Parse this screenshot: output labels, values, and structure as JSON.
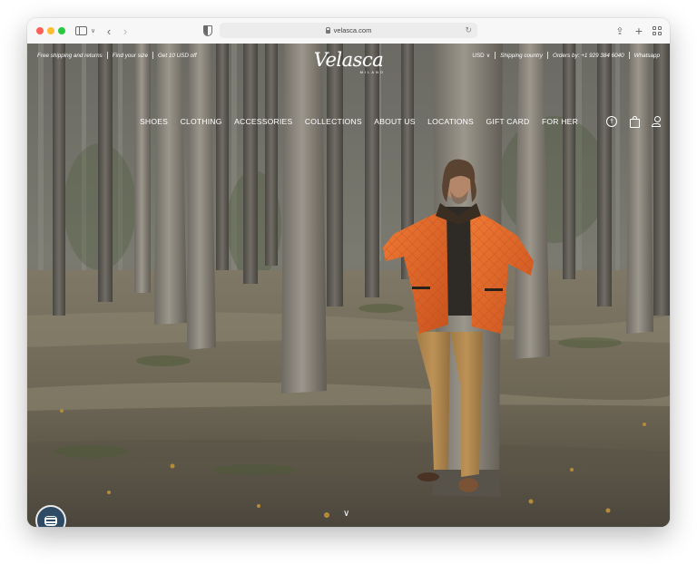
{
  "browser": {
    "url": "velasca.com"
  },
  "topbar": {
    "left": [
      "Free shipping and returns",
      "Find your size",
      "Get 10 USD off"
    ],
    "currency": "USD",
    "right": [
      "Shipping country",
      "Orders by: +1 929 384 6040",
      "Whatsapp"
    ]
  },
  "logo": {
    "name": "Velasca",
    "sub": "MILANO"
  },
  "nav": {
    "items": [
      "SHOES",
      "CLOTHING",
      "ACCESSORIES",
      "COLLECTIONS",
      "ABOUT US",
      "LOCATIONS",
      "GIFT CARD",
      "FOR HER"
    ]
  },
  "icons": [
    "accessibility-icon",
    "shopping-bag-icon",
    "account-icon",
    "chat-icon",
    "chevron-down-icon"
  ],
  "colors": {
    "jacket": "#e2662a",
    "chat_button": "#2f4a65",
    "text_on_image": "#ffffff"
  }
}
